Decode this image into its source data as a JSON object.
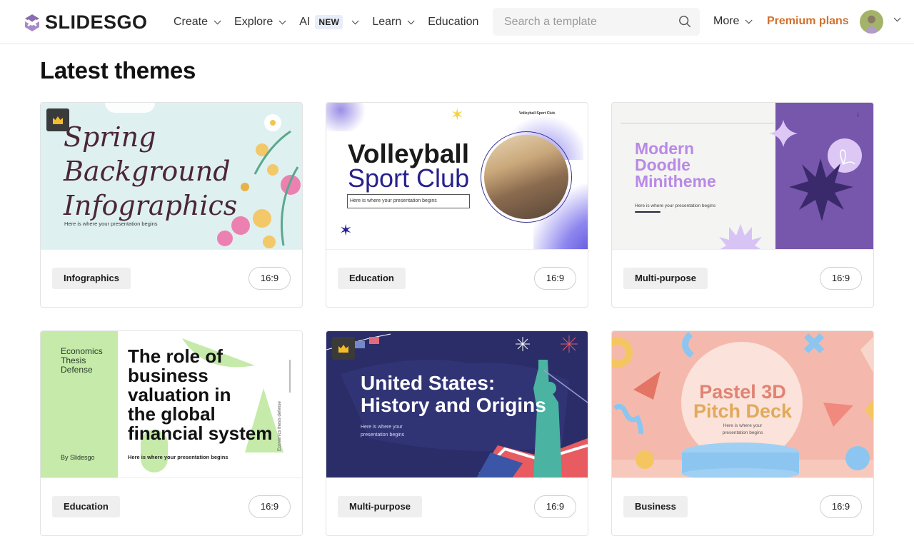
{
  "header": {
    "logo_text": "SLIDESGO",
    "nav": [
      {
        "label": "Create",
        "has_dropdown": true
      },
      {
        "label": "Explore",
        "has_dropdown": true
      },
      {
        "label": "AI",
        "badge": "NEW",
        "has_dropdown": true
      },
      {
        "label": "Learn",
        "has_dropdown": true
      },
      {
        "label": "Education",
        "has_dropdown": false
      }
    ],
    "search": {
      "placeholder": "Search a template",
      "value": "",
      "icon": "search-icon"
    },
    "more_label": "More",
    "premium_label": "Premium plans",
    "avatar": "user-avatar"
  },
  "colors": {
    "premium": "#d1702e",
    "logo": "#8a6cb0",
    "tag_bg": "#efefef"
  },
  "main": {
    "title": "Latest themes",
    "cards": [
      {
        "category": "Infographics",
        "ratio": "16:9",
        "premium": true,
        "thumb": {
          "title_lines": [
            "Spring",
            "Background",
            "Infographics"
          ],
          "subtitle": "Here is where your presentation begins"
        }
      },
      {
        "category": "Education",
        "ratio": "16:9",
        "premium": false,
        "thumb": {
          "title_lines": [
            "Volleyball",
            "Sport Club"
          ],
          "subtitle": "Here is where your presentation begins",
          "brand": "Volleyball Sport Club"
        }
      },
      {
        "category": "Multi-purpose",
        "ratio": "16:9",
        "premium": false,
        "thumb": {
          "title_lines": [
            "Modern",
            "Doodle",
            "Minitheme"
          ],
          "subtitle": "Here is where your presentation begins"
        }
      },
      {
        "category": "Education",
        "ratio": "16:9",
        "premium": false,
        "thumb": {
          "side_lines": [
            "Economics",
            "Thesis",
            "Defense"
          ],
          "by": "By Slidesgo",
          "title_lines": [
            "The role of",
            "business",
            "valuation in",
            "the global",
            "financial system"
          ],
          "subtitle": "Here is where your presentation begins",
          "vertical": "Economics thesis defense"
        }
      },
      {
        "category": "Multi-purpose",
        "ratio": "16:9",
        "premium": true,
        "thumb": {
          "title_lines": [
            "United States:",
            "History and Origins"
          ],
          "subtitle_lines": [
            "Here is where your",
            "presentation begins"
          ]
        }
      },
      {
        "category": "Business",
        "ratio": "16:9",
        "premium": false,
        "thumb": {
          "title_lines": [
            "Pastel 3D",
            "Pitch Deck"
          ],
          "subtitle_lines": [
            "Here is where your",
            "presentation begins"
          ]
        }
      }
    ]
  }
}
